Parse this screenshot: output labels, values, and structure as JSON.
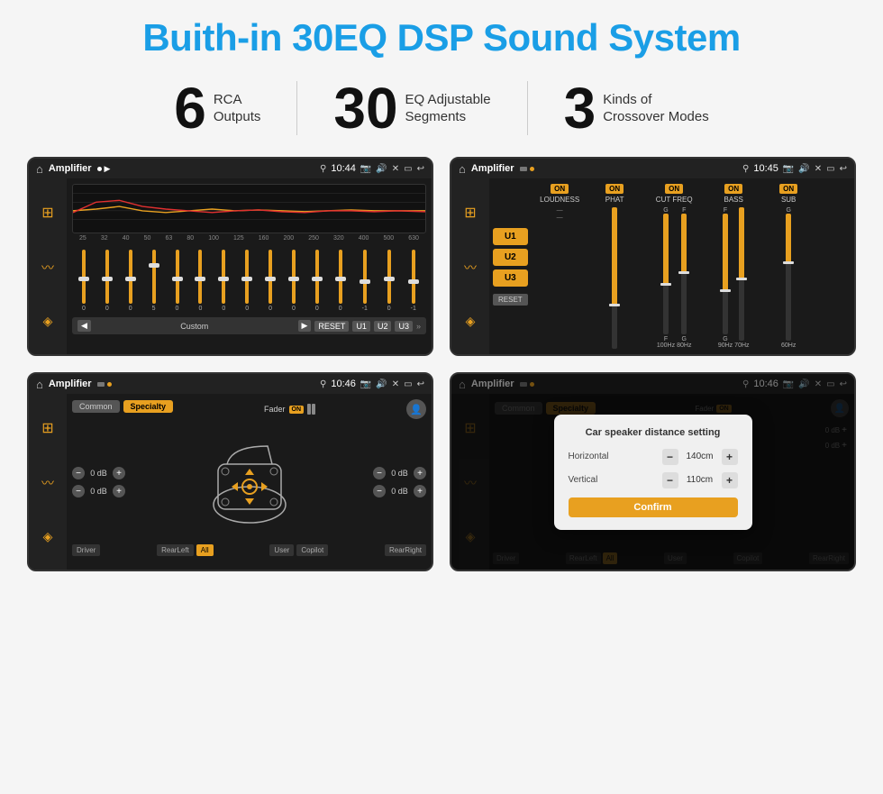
{
  "page": {
    "title": "Buith-in 30EQ DSP Sound System",
    "background": "#f5f5f5"
  },
  "stats": [
    {
      "number": "6",
      "label": "RCA\nOutputs"
    },
    {
      "number": "30",
      "label": "EQ Adjustable\nSegments"
    },
    {
      "number": "3",
      "label": "Kinds of\nCrossover Modes"
    }
  ],
  "screens": [
    {
      "id": "screen1",
      "statusBar": {
        "appTitle": "Amplifier",
        "time": "10:44"
      },
      "type": "eq"
    },
    {
      "id": "screen2",
      "statusBar": {
        "appTitle": "Amplifier",
        "time": "10:45"
      },
      "type": "crossover",
      "uButtons": [
        "U1",
        "U2",
        "U3"
      ],
      "channels": [
        {
          "on": true,
          "name": "LOUDNESS"
        },
        {
          "on": true,
          "name": "PHAT"
        },
        {
          "on": true,
          "name": "CUT FREQ"
        },
        {
          "on": true,
          "name": "BASS"
        },
        {
          "on": true,
          "name": "SUB"
        }
      ]
    },
    {
      "id": "screen3",
      "statusBar": {
        "appTitle": "Amplifier",
        "time": "10:46"
      },
      "type": "fader",
      "tabs": [
        "Common",
        "Specialty"
      ],
      "activeTab": 1,
      "faderLabel": "Fader",
      "faderOn": true,
      "dbValues": [
        "0 dB",
        "0 dB",
        "0 dB",
        "0 dB"
      ],
      "bottomLabels": [
        "Driver",
        "RearLeft",
        "All",
        "User",
        "Copilot",
        "RearRight"
      ]
    },
    {
      "id": "screen4",
      "statusBar": {
        "appTitle": "Amplifier",
        "time": "10:46"
      },
      "type": "distance",
      "modal": {
        "title": "Car speaker distance setting",
        "horizontalLabel": "Horizontal",
        "horizontalValue": "140cm",
        "verticalLabel": "Vertical",
        "verticalValue": "110cm",
        "confirmLabel": "Confirm"
      },
      "dbValues": [
        "0 dB",
        "0 dB"
      ],
      "bottomLabels": [
        "Driver",
        "RearLeft",
        "All",
        "User",
        "Copilot",
        "RearRight"
      ]
    }
  ],
  "eqFreqs": [
    "25",
    "32",
    "40",
    "50",
    "63",
    "80",
    "100",
    "125",
    "160",
    "200",
    "250",
    "320",
    "400",
    "500",
    "630"
  ],
  "eqValues": [
    "0",
    "0",
    "0",
    "5",
    "0",
    "0",
    "0",
    "0",
    "0",
    "0",
    "0",
    "0",
    "-1",
    "0",
    "-1"
  ],
  "controls": {
    "resetLabel": "RESET",
    "u1Label": "U1",
    "u2Label": "U2",
    "u3Label": "U3",
    "customLabel": "Custom"
  }
}
